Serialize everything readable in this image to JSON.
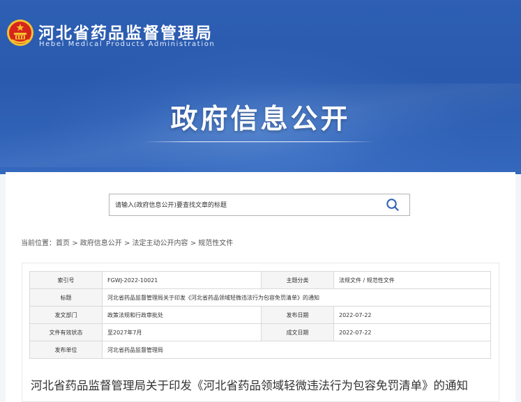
{
  "header": {
    "site_name": "河北省药品监督管理局",
    "site_name_en": "Hebei Medical Products Administration",
    "section_title": "政府信息公开"
  },
  "search": {
    "placeholder": "请输入(政府信息公开)要查找文章的标题"
  },
  "breadcrumb": {
    "prefix": "当前位置：",
    "items": [
      "首页",
      "政府信息公开",
      "法定主动公开内容",
      "规范性文件"
    ],
    "separator": ">"
  },
  "meta": {
    "index_label": "索引号",
    "index_value": "FGWJ-2022-10021",
    "topic_label": "主题分类",
    "topic_value": "法规文件 / 规范性文件",
    "title_label": "标题",
    "title_value": "河北省药品监督管理局关于印发《河北省药品领域轻微违法行为包容免罚清单》的通知",
    "dept_label": "发文部门",
    "dept_value": "政策法规和行政审批处",
    "pub_date_label": "发布日期",
    "pub_date_value": "2022-07-22",
    "status_label": "文件有效状态",
    "status_value": "至2027年7月",
    "made_date_label": "成文日期",
    "made_date_value": "2022-07-22",
    "issuer_label": "发布单位",
    "issuer_value": "河北省药品监督管理局"
  },
  "document": {
    "title": "河北省药品监督管理局关于印发《河北省药品领域轻微违法行为包容免罚清单》的通知"
  },
  "colors": {
    "banner_blue": "#2d5fb4",
    "emblem_red": "#d7251b",
    "emblem_gold": "#f2c230"
  },
  "icons": {
    "emblem": "national-emblem-icon",
    "search": "search-icon"
  }
}
